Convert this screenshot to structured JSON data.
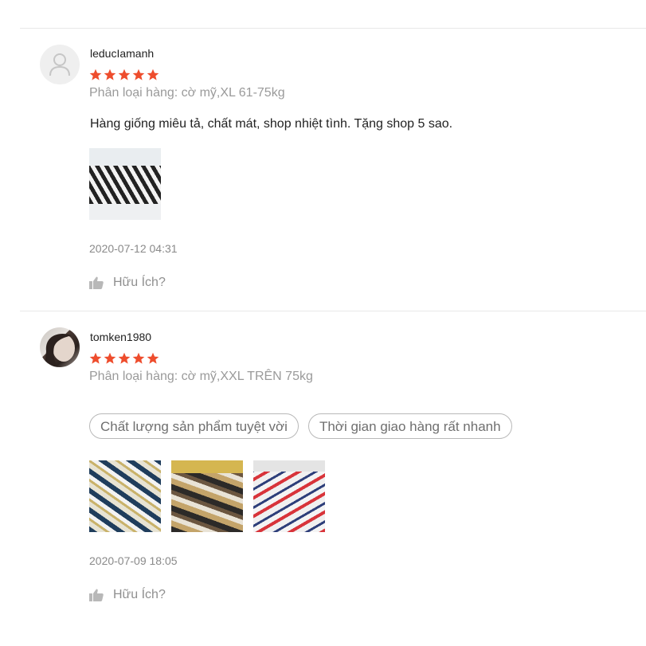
{
  "colors": {
    "star": "#ee4d2d",
    "muted_text": "#9a9a9a",
    "divider": "#e8e8e8"
  },
  "reviews": [
    {
      "username": "leducIamanh",
      "avatar_icon": "default-user-icon",
      "rating": 5,
      "rating_max": 5,
      "variation": "Phân loại hàng: cờ mỹ,XL 61-75kg",
      "comment": "Hàng giống miêu tả, chất mát, shop nhiệt tình. Tặng shop 5 sao.",
      "photos": 1,
      "date": "2020-07-12 04:31",
      "helpful_label": "Hữu Ích?",
      "helpful_icon": "thumbs-up-icon"
    },
    {
      "username": "tomken1980",
      "avatar_icon": "user-photo",
      "rating": 5,
      "rating_max": 5,
      "variation": "Phân loại hàng: cờ mỹ,XXL TRÊN 75kg",
      "tags": [
        "Chất lượng sản phẩm tuyệt vời",
        "Thời gian giao hàng rất nhanh"
      ],
      "photos": 3,
      "date": "2020-07-09 18:05",
      "helpful_label": "Hữu Ích?",
      "helpful_icon": "thumbs-up-icon"
    }
  ]
}
